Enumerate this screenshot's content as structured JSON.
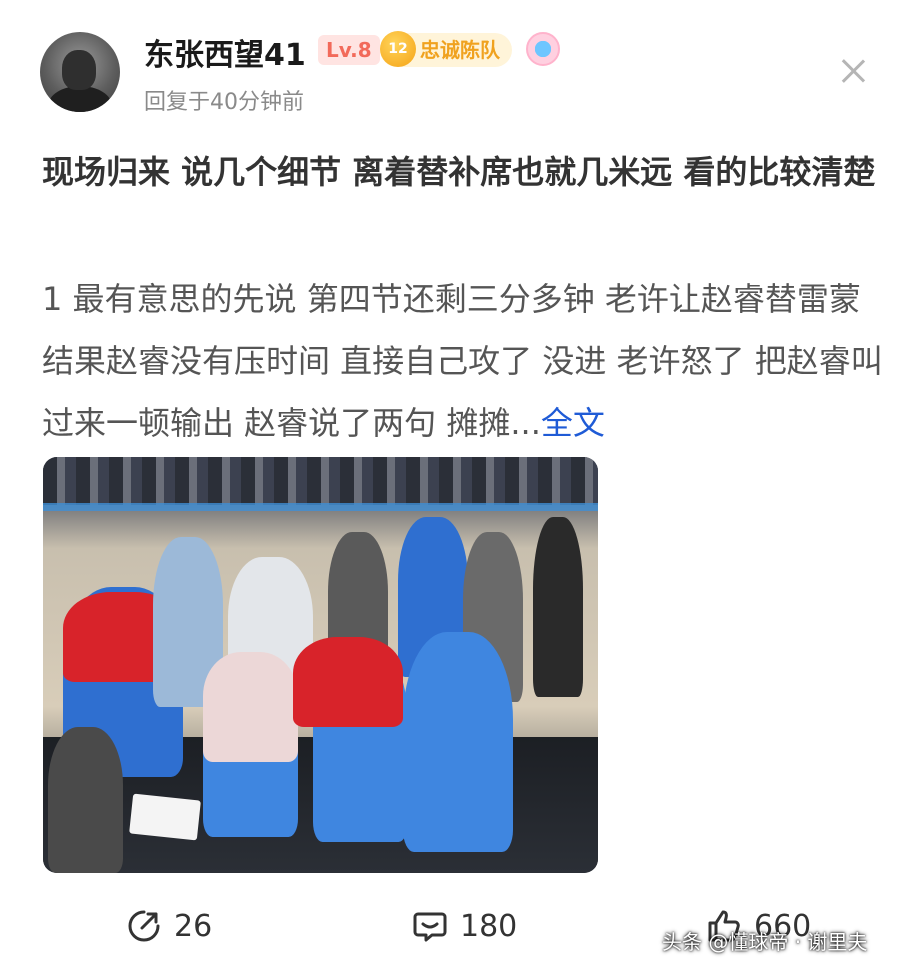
{
  "header": {
    "username": "东张西望41",
    "level_badge": "Lv.8",
    "fan_level": "12",
    "fan_badge": "忠诚陈队",
    "reply_time": "回复于40分钟前"
  },
  "post": {
    "title": "现场归来 说几个细节 离着替补席也就几米远 看的比较清楚",
    "body": "1 最有意思的先说 第四节还剩三分多钟 老许让赵睿替雷蒙 结果赵睿没有压时间 直接自己攻了 没进 老许怒了 把赵睿叫过来一顿输出 赵睿说了两句 摊摊...",
    "more_label": "全文"
  },
  "stats": {
    "shares": "26",
    "comments": "180",
    "likes": "660"
  },
  "watermark": "头条 @懂球帝 · 谢里夫",
  "icons": {
    "share": "share-icon",
    "comment": "comment-icon",
    "like": "like-icon",
    "close": "close-icon",
    "verify": "verify-icon"
  },
  "colors": {
    "link": "#1f5bd6",
    "level_badge": "#f26a5a",
    "fan_badge": "#f0a21f"
  }
}
